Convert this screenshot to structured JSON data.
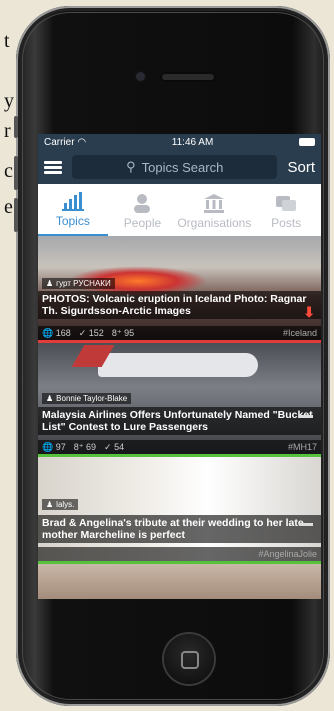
{
  "page_margin_text": [
    "t",
    "y",
    "r",
    "c",
    "e"
  ],
  "status": {
    "carrier": "Carrier",
    "time": "11:46 AM"
  },
  "navbar": {
    "search_placeholder": "Topics Search",
    "sort_label": "Sort"
  },
  "tabs": [
    {
      "label": "Topics",
      "icon": "bar-chart-icon",
      "active": true
    },
    {
      "label": "People",
      "icon": "person-icon",
      "active": false
    },
    {
      "label": "Organisations",
      "icon": "building-icon",
      "active": false
    },
    {
      "label": "Posts",
      "icon": "posts-icon",
      "active": false
    }
  ],
  "cards": [
    {
      "author": "гурт РУСНАКИ",
      "title": "PHOTOS: Volcanic eruption in Iceland Photo: Ragnar Th. Sigurdsson-Arctic Images",
      "shares": "168",
      "tweets": "152",
      "plus": "95",
      "tag": "#Iceland",
      "accent": "#e23b3b"
    },
    {
      "author": "Bonnie Taylor-Blake",
      "title": "Malaysia Airlines Offers Unfortunately Named \"Bucket List\" Contest to Lure Passengers",
      "shares": "97",
      "plus": "69",
      "tweets": "54",
      "tag": "#MH17",
      "accent": "#56c13c"
    },
    {
      "author": "lalys.",
      "title": "Brad & Angelina's tribute at their wedding to her late mother Marcheline is perfect",
      "tag": "#AngelinaJolie",
      "accent": "#56c13c"
    }
  ]
}
